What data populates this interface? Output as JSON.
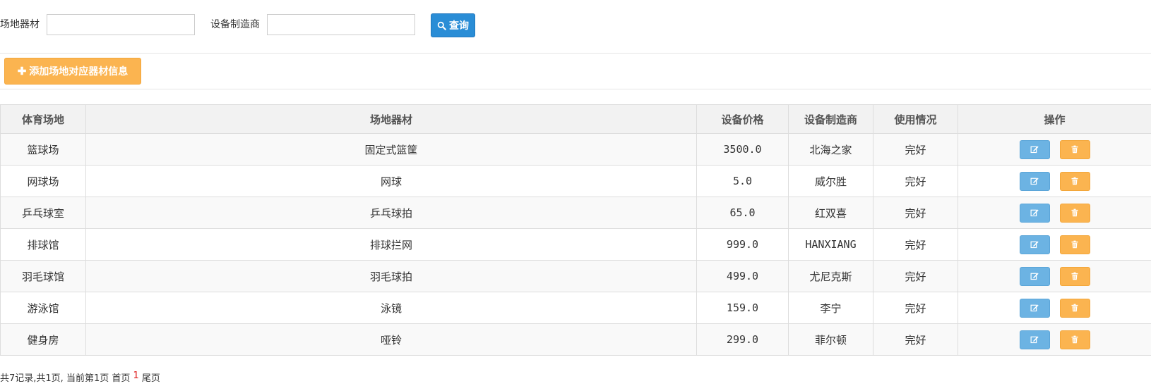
{
  "search": {
    "equipment_label": "场地器材",
    "equipment_value": "",
    "manufacturer_label": "设备制造商",
    "manufacturer_value": "",
    "query_label": "查询"
  },
  "toolbar": {
    "add_label": "添加场地对应器材信息"
  },
  "table": {
    "headers": {
      "venue": "体育场地",
      "equipment": "场地器材",
      "price": "设备价格",
      "manufacturer": "设备制造商",
      "status": "使用情况",
      "actions": "操作"
    },
    "rows": [
      {
        "venue": "篮球场",
        "equipment": "固定式篮筐",
        "price": "3500.0",
        "manufacturer": "北海之家",
        "status": "完好"
      },
      {
        "venue": "网球场",
        "equipment": "网球",
        "price": "5.0",
        "manufacturer": "威尔胜",
        "status": "完好"
      },
      {
        "venue": "乒乓球室",
        "equipment": "乒乓球拍",
        "price": "65.0",
        "manufacturer": "红双喜",
        "status": "完好"
      },
      {
        "venue": "排球馆",
        "equipment": "排球拦网",
        "price": "999.0",
        "manufacturer": "HANXIANG",
        "status": "完好"
      },
      {
        "venue": "羽毛球馆",
        "equipment": "羽毛球拍",
        "price": "499.0",
        "manufacturer": "尤尼克斯",
        "status": "完好"
      },
      {
        "venue": "游泳馆",
        "equipment": "泳镜",
        "price": "159.0",
        "manufacturer": "李宁",
        "status": "完好"
      },
      {
        "venue": "健身房",
        "equipment": "哑铃",
        "price": "299.0",
        "manufacturer": "菲尔顿",
        "status": "完好"
      }
    ]
  },
  "pager": {
    "summary": "共7记录,共1页, 当前第1页 ",
    "first": "首页",
    "current": "1",
    "last": "尾页"
  },
  "colors": {
    "primary": "#2a8dd6",
    "warning": "#fbb450",
    "info": "#6cb3e3",
    "current_page": "#e02020"
  },
  "icons": {
    "query": "search-icon",
    "add": "plus-icon",
    "edit": "edit-icon",
    "delete": "trash-icon"
  }
}
